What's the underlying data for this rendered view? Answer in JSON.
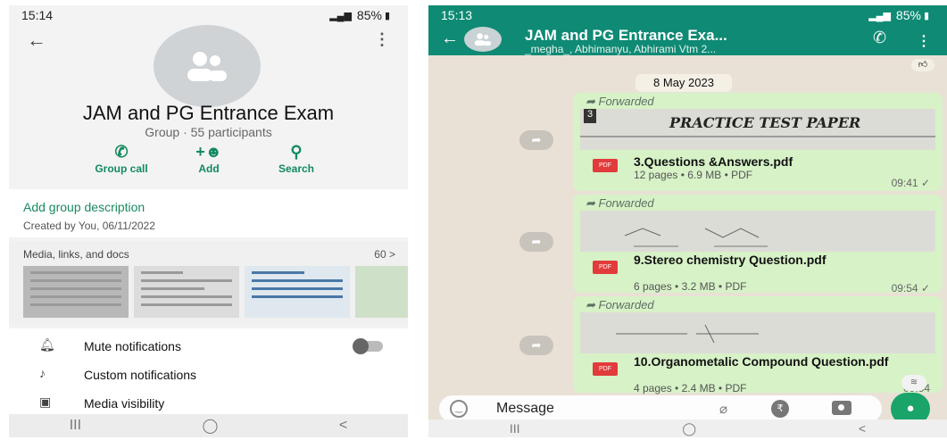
{
  "left": {
    "status": {
      "time": "15:14",
      "battery": "85%"
    },
    "group_name": "JAM and PG Entrance Exam",
    "group_sub": "Group · 55 participants",
    "actions": [
      {
        "icon": "call-add-icon",
        "label": "Group call"
      },
      {
        "icon": "person-add-icon",
        "label": "Add"
      },
      {
        "icon": "search-icon",
        "label": "Search"
      }
    ],
    "description": {
      "link": "Add group description",
      "created": "Created by You, 06/11/2022"
    },
    "media": {
      "heading": "Media, links, and docs",
      "count": "60 >"
    },
    "settings": [
      {
        "icon": "bell-icon",
        "label": "Mute notifications"
      },
      {
        "icon": "music-note-icon",
        "label": "Custom notifications"
      },
      {
        "icon": "image-icon",
        "label": "Media visibility"
      }
    ],
    "nav": [
      "III",
      "◯",
      "<"
    ]
  },
  "right": {
    "status": {
      "time": "15:13",
      "battery": "85%"
    },
    "title": "JAM and PG Entrance Exa...",
    "subtitle": "_megha_, Abhimanyu, Abhirami Vtm 2...",
    "date": "8 May 2023",
    "forwarded_label": "Forwarded",
    "messages": [
      {
        "preview_title": "PRACTICE TEST PAPER",
        "preview_badge": "3",
        "file_name": "3.Questions &Answers.pdf",
        "meta": "12 pages • 6.9 MB • PDF",
        "time": "09:41"
      },
      {
        "preview_title": "",
        "preview_badge": "",
        "file_name": "9.Stereo chemistry Question.pdf",
        "meta": "6 pages • 3.2 MB • PDF",
        "time": "09:54"
      },
      {
        "preview_title": "",
        "preview_badge": "",
        "file_name": "10.Organometalic Compound Question.pdf",
        "meta": "4 pages • 2.4 MB • PDF",
        "time": "09:54"
      }
    ],
    "pdf_label": "PDF",
    "input_placeholder": "Message",
    "nav": [
      "III",
      "◯",
      "<"
    ],
    "colors": {
      "header": "#0f8a74",
      "bubble": "#d7f2c7",
      "accent": "#1aa46a"
    }
  }
}
